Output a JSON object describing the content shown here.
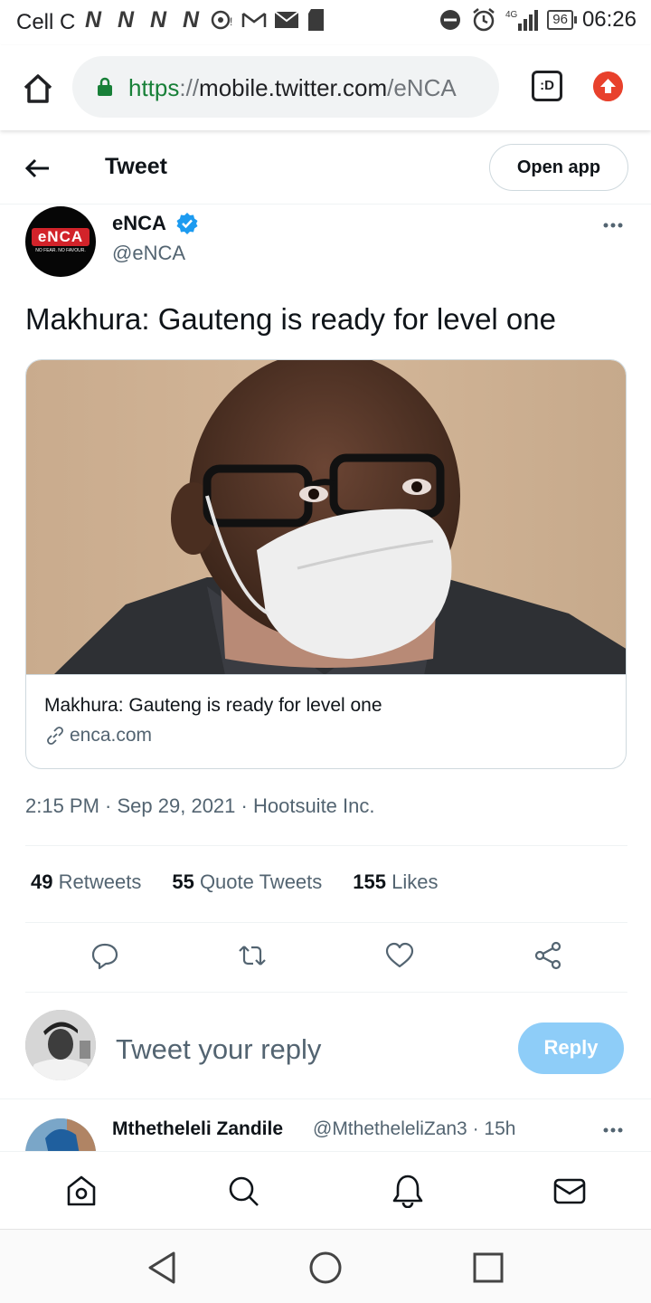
{
  "status_bar": {
    "carrier": "Cell C",
    "battery": "96",
    "time": "06:26",
    "network": "4G",
    "notification_icons": [
      "N",
      "N",
      "N",
      "N"
    ]
  },
  "browser": {
    "url_protocol": "https",
    "url_separator": "://",
    "url_host": "mobile.twitter.com",
    "url_path": "/eNCA",
    "tabs_label": ":D"
  },
  "header": {
    "title": "Tweet",
    "open_app_label": "Open app"
  },
  "tweet": {
    "author_name": "eNCA",
    "author_handle": "@eNCA",
    "avatar_logo_text": "eNCA",
    "avatar_tagline": "NO FEAR. NO FAVOUR.",
    "text": "Makhura: Gauteng is ready for level one",
    "card_title": "Makhura: Gauteng is ready for level one",
    "card_domain": "enca.com",
    "timestamp": "2:15 PM",
    "date": "Sep 29, 2021",
    "source": "Hootsuite Inc.",
    "separator": " · "
  },
  "stats": {
    "retweets_count": "49",
    "retweets_label": "Retweets",
    "quotes_count": "55",
    "quotes_label": "Quote Tweets",
    "likes_count": "155",
    "likes_label": "Likes"
  },
  "reply": {
    "placeholder": "Tweet your reply",
    "button_label": "Reply"
  },
  "next_reply": {
    "name": "Mthetheleli Zandile",
    "handle": "@MthetheleliZan3",
    "time": "15h",
    "separator": " · "
  },
  "colors": {
    "brand_blue": "#1d9bf0",
    "reply_button": "#8ecdf8",
    "secure_green": "#188038",
    "update_red": "#e8412c",
    "enca_red": "#d2232a"
  }
}
